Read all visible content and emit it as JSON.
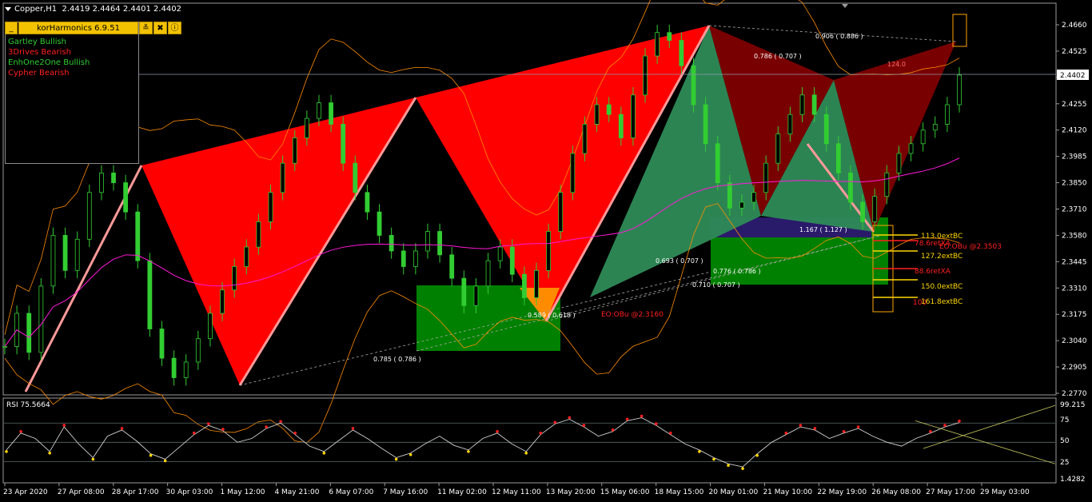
{
  "title": {
    "symbol_tf": "Copper,H1",
    "ohlc": "2.4419 2.4464 2.4401 2.4402"
  },
  "toolbar": {
    "minimize_label": "_",
    "name": "korHarmonics 6.9.51",
    "settings_icon": "sliders-icon",
    "tools_icon": "tools-icon",
    "info_icon": "info-icon"
  },
  "legend": [
    {
      "label": "Gartley Bullish",
      "color": "#32cd32"
    },
    {
      "label": "3Drives Bearish",
      "color": "#ff2020"
    },
    {
      "label": "EnhOne2One Bullish",
      "color": "#32cd32"
    },
    {
      "label": "Cypher Bearish",
      "color": "#ff2020"
    }
  ],
  "price_axis": {
    "ticks": [
      "2.4660",
      "2.4525",
      "2.4395",
      "2.4255",
      "2.4120",
      "2.3985",
      "2.3850",
      "2.3710",
      "2.3580",
      "2.3445",
      "2.3310",
      "2.3175",
      "2.3040",
      "2.2905",
      "2.2770"
    ],
    "current_price": "2.4402"
  },
  "time_axis": [
    "23 Apr 2020",
    "27 Apr 08:00",
    "28 Apr 17:00",
    "30 Apr 03:00",
    "1 May 12:00",
    "4 May 21:00",
    "6 May 07:00",
    "7 May 16:00",
    "11 May 02:00",
    "12 May 11:00",
    "13 May 20:00",
    "15 May 06:00",
    "18 May 15:00",
    "20 May 01:00",
    "21 May 10:00",
    "22 May 19:00",
    "26 May 08:00",
    "27 May 17:00",
    "29 May 03:00"
  ],
  "rsi": {
    "label": "RSI 75.5664",
    "ticks": [
      "99.215",
      "75",
      "50",
      "25",
      "1.4282"
    ]
  },
  "annotations": {
    "ratio_top": "0.906 ( 0.886 )",
    "ratio_cypher": "0.786 ( 0.707 )",
    "ratio_label_124": "124.0",
    "ratio_1167": "1.167 ( 1.127 )",
    "ratio_0693": "0.693 ( 0.707 )",
    "ratio_0776": "0.776 ( 0.786 )",
    "ratio_0710": "0.710 ( 0.707 )",
    "ratio_0589": "0.589 ( 0.618 )",
    "ratio_0785": "0.785 ( 0.786 )",
    "eo_label_1": "EO:OBu   @2.3160",
    "eo_label_2": "EO:OBu   @2.3503",
    "ext_113": "113.0extBC",
    "ext_127": "127.2extBC",
    "ret_886": "88.6retXA",
    "ext_150": "150.0extBC",
    "ext_161": "161.8extBC",
    "ret_786_short": "78.6retXA",
    "ret_100": "100"
  },
  "colors": {
    "candles": "#32cd32",
    "bearish_fill": "#ff0000",
    "bearish_dark": "#800000",
    "bullish_fill": "#2e8b57",
    "prz_green": "#008000",
    "ma_magenta": "#ff1ad9",
    "bands_orange": "#ff8c00",
    "highlight": "#ffa500"
  },
  "chart_data": [
    {
      "type": "line",
      "title": "",
      "series": [
        {
          "values": [
            2.301,
            2.318,
            2.298,
            2.332,
            2.358,
            2.34,
            2.356,
            2.38,
            2.39,
            2.385,
            2.37,
            2.345,
            2.31,
            2.295,
            2.285,
            2.293,
            2.305,
            2.318,
            2.33,
            2.342,
            2.352,
            2.365,
            2.38,
            2.395,
            2.408,
            2.418,
            2.426,
            2.415,
            2.395,
            2.38,
            2.37,
            2.358,
            2.35,
            2.342,
            2.35,
            2.36,
            2.348,
            2.336,
            2.322,
            2.332,
            2.345,
            2.352,
            2.338,
            2.326,
            2.34,
            2.36,
            2.38,
            2.4,
            2.415,
            2.425,
            2.42,
            2.408,
            2.43,
            2.45,
            2.462,
            2.458,
            2.445,
            2.425,
            2.405,
            2.385,
            2.372,
            2.375,
            2.38,
            2.395,
            2.41,
            2.42,
            2.43,
            2.42,
            2.405,
            2.39,
            2.375,
            2.365,
            2.378,
            2.39,
            2.4,
            2.405,
            2.412,
            2.415,
            2.425,
            2.4402
          ]
        }
      ],
      "ylim": [
        2.277,
        2.466
      ],
      "grid": false
    },
    {
      "type": "line",
      "title": "",
      "series": [
        {
          "values": [
            40,
            62,
            55,
            38,
            70,
            48,
            30,
            58,
            66,
            52,
            35,
            28,
            44,
            60,
            72,
            65,
            50,
            55,
            68,
            75,
            60,
            45,
            38,
            52,
            66,
            55,
            42,
            30,
            36,
            48,
            58,
            46,
            40,
            55,
            62,
            48,
            38,
            60,
            74,
            80,
            70,
            58,
            64,
            78,
            82,
            72,
            60,
            48,
            40,
            30,
            22,
            18,
            35,
            50,
            60,
            70,
            66,
            55,
            62,
            68,
            58,
            50,
            45,
            55,
            62,
            70,
            75.57
          ]
        }
      ],
      "ylim": [
        1.4282,
        99.215
      ]
    }
  ]
}
